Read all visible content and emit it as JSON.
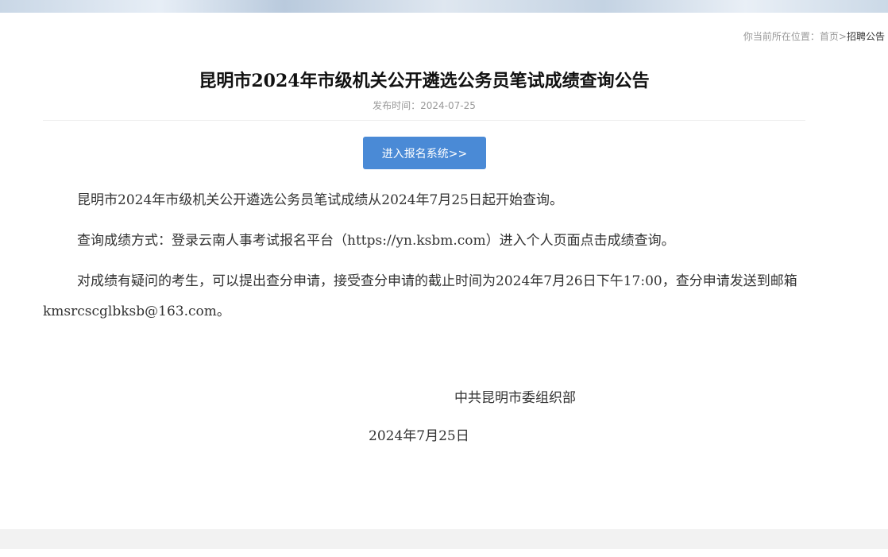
{
  "breadcrumb": {
    "prefix": "你当前所在位置：",
    "home": "首页",
    "separator": ">",
    "current": "招聘公告"
  },
  "article": {
    "title": "昆明市2024年市级机关公开遴选公务员笔试成绩查询公告",
    "publish_time": "发布时间：2024-07-25",
    "register_button": "进入报名系统>>",
    "paragraphs": [
      "昆明市2024年市级机关公开遴选公务员笔试成绩从2024年7月25日起开始查询。",
      "查询成绩方式：登录云南人事考试报名平台（https://yn.ksbm.com）进入个人页面点击成绩查询。",
      "对成绩有疑问的考生，可以提出查分申请，接受查分申请的截止时间为2024年7月26日下午17:00，查分申请发送到邮箱kmsrcscglbksb@163.com。"
    ],
    "signature_org": "中共昆明市委组织部",
    "signature_date": "2024年7月25日"
  },
  "colors": {
    "button_bg": "#4a8ad6",
    "text": "#333333",
    "muted": "#999999"
  }
}
